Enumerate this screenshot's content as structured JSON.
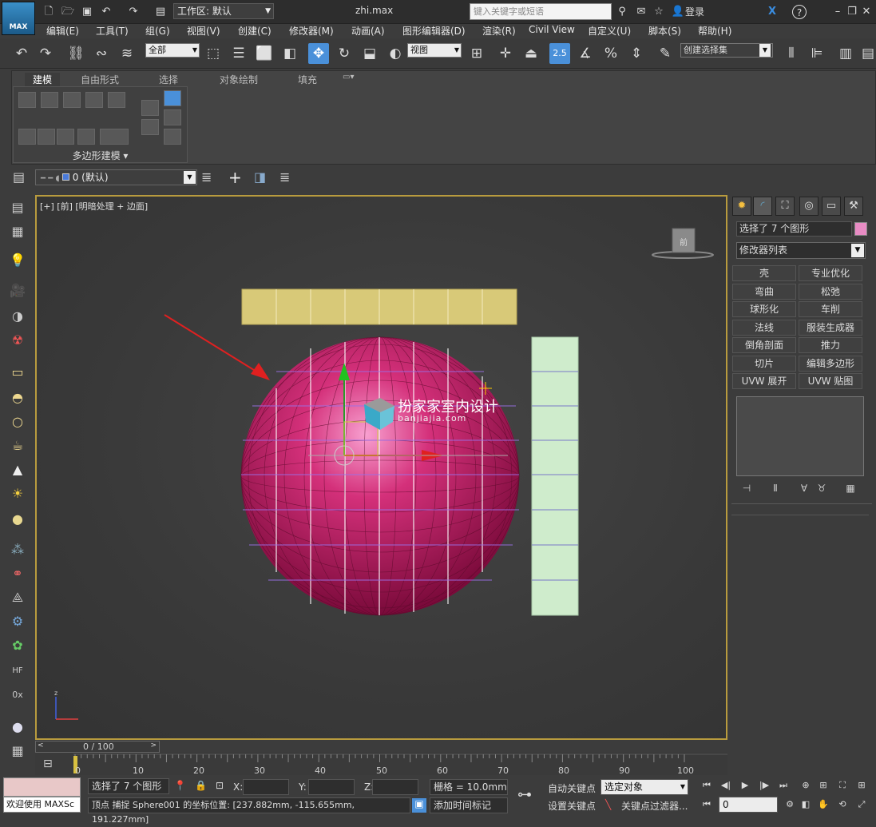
{
  "app": {
    "logo_text": "MAX",
    "doc_title": "zhi.max",
    "workspace": "工作区: 默认",
    "search_placeholder": "键入关键字或短语",
    "login": "登录",
    "help_icon": "?"
  },
  "menu": [
    "编辑(E)",
    "工具(T)",
    "组(G)",
    "视图(V)",
    "创建(C)",
    "修改器(M)",
    "动画(A)",
    "图形编辑器(D)",
    "渲染(R)",
    "Civil View",
    "自定义(U)",
    "脚本(S)",
    "帮助(H)"
  ],
  "toolbar": {
    "filter": "全部",
    "ref_coord": "视图",
    "snap_value": "2.5",
    "named_sel": "创建选择集"
  },
  "ribbon": {
    "tabs": [
      "建模",
      "自由形式",
      "选择",
      "对象绘制",
      "填充"
    ],
    "active_tab": "建模",
    "panel_label": "多边形建模 ▾"
  },
  "layer": {
    "current": "0 (默认)"
  },
  "viewport": {
    "label": "[+] [前] [明暗处理 + 边面]",
    "watermark_title": "扮家家室内设计",
    "watermark_url": "banjiajia.com"
  },
  "command_panel": {
    "selection_info": "选择了 7 个图形",
    "selection_color": "#e88cc4",
    "modifier_list": "修改器列表",
    "modifier_buttons": [
      "壳",
      "专业优化",
      "弯曲",
      "松弛",
      "球形化",
      "车削",
      "法线",
      "服装生成器",
      "倒角剖面",
      "推力",
      "切片",
      "编辑多边形",
      "UVW 展开",
      "UVW 贴图"
    ]
  },
  "timeline": {
    "slider": "0 / 100",
    "ticks": [
      "0",
      "10",
      "20",
      "30",
      "40",
      "50",
      "60",
      "70",
      "80",
      "90",
      "100"
    ]
  },
  "status": {
    "welcome": "欢迎使用 MAXSc",
    "selected": "选择了 7 个图形",
    "prompt": "顶点 捕捉 Sphere001 的坐标位置:  [237.882mm, -115.655mm, 191.227mm]",
    "x_label": "X:",
    "y_label": "Y:",
    "z_label": "Z:",
    "grid": "栅格 = 10.0mm",
    "add_time_tag": "添加时间标记",
    "auto_key": "自动关键点",
    "set_key": "设置关键点",
    "key_mode": "选定对象",
    "key_filters": "关键点过滤器...",
    "frame": "0"
  },
  "colors": {
    "sphere": "#c2185b",
    "top_plane": "#d8c978",
    "side_plane": "#cfeccc",
    "viewport_border": "#b89b3e",
    "arrow": "#e02020"
  }
}
